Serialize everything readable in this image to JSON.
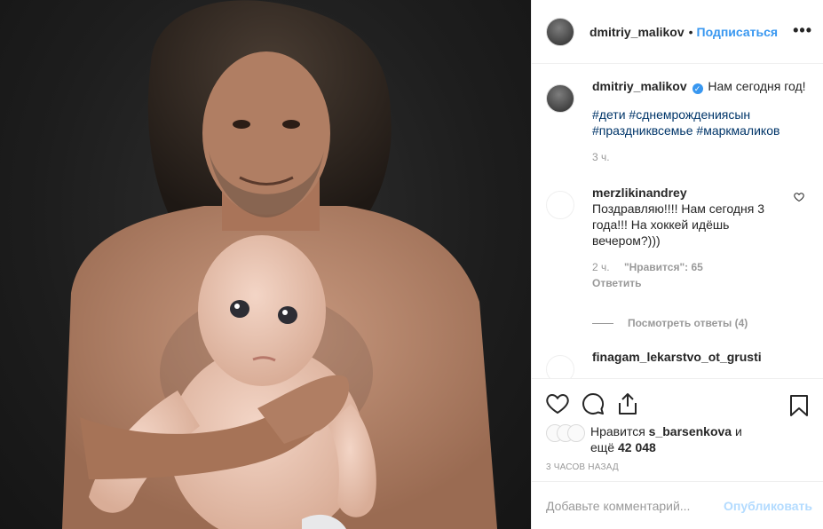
{
  "post": {
    "username": "dmitriy_malikov",
    "follow_label": "Подписаться",
    "dot": "•",
    "more_label": "•••"
  },
  "caption": {
    "username": "dmitriy_malikov",
    "verified_glyph": "✓",
    "text": "Нам сегодня год!",
    "hashtags": [
      "#дети",
      "#сднемрождениясын",
      "#праздниквсемье",
      "#маркмаликов"
    ],
    "time": "3 ч."
  },
  "comments": [
    {
      "username": "merzlikinandrey",
      "text": "Поздравляю!!!! Нам сегодня 3 года!!! На хоккей идёшь вечером?)))",
      "time": "2 ч.",
      "likes": "\"Нравится\": 65",
      "reply_label": "Ответить",
      "view_replies": "Посмотреть ответы (4)"
    },
    {
      "username": "finagam_lekarstvo_ot_grusti"
    }
  ],
  "likes": {
    "prefix": "Нравится",
    "user": "s_barsenkova",
    "mid": "и",
    "more_prefix": "ещё",
    "count": "42 048"
  },
  "timestamp": "3 часов назад",
  "add_comment": {
    "placeholder": "Добавьте комментарий...",
    "publish_label": "Опубликовать"
  },
  "icons": {
    "like": "heart-icon",
    "comment": "comment-icon",
    "share": "share-icon",
    "save": "bookmark-icon",
    "more": "more-options-icon",
    "verified": "verified-badge-icon",
    "comment_like": "heart-outline-icon"
  },
  "colors": {
    "link": "#3897f0",
    "hashtag": "#003569",
    "muted": "#999999",
    "publish_disabled": "#b3dbff"
  }
}
